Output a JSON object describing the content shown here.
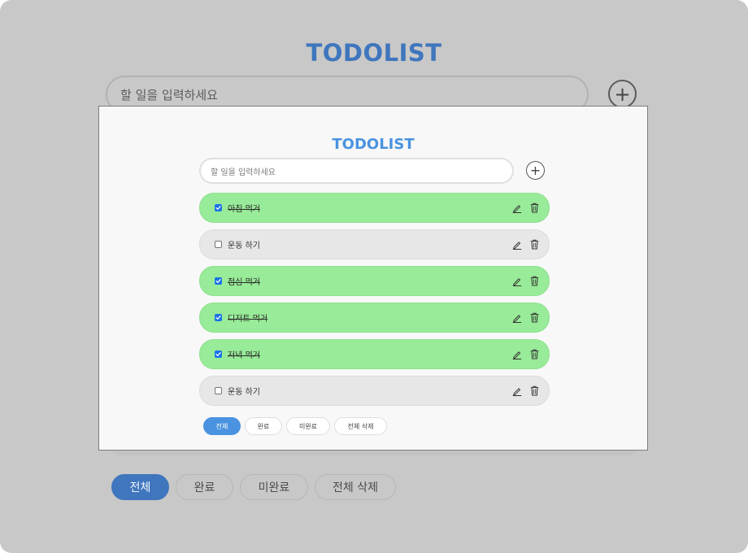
{
  "background": {
    "title": "TODOLIST",
    "input_placeholder": "할 일을 입력하세요",
    "add_symbol": "+",
    "filters": [
      "전체",
      "완료",
      "미완료",
      "전체 삭제"
    ]
  },
  "modal": {
    "title": "TODOLIST",
    "input_placeholder": "할 일을 입력하세요",
    "add_symbol": "+",
    "todos": [
      {
        "text": "아침 먹거",
        "done": true
      },
      {
        "text": "운동 하기",
        "done": false
      },
      {
        "text": "점심 먹거",
        "done": true
      },
      {
        "text": "디저트 먹거",
        "done": true
      },
      {
        "text": "저녁 먹거",
        "done": true
      },
      {
        "text": "운동 하기",
        "done": false
      }
    ],
    "filters": [
      "전체",
      "완료",
      "미완료",
      "전체 삭제"
    ],
    "active_filter": "전체"
  },
  "colors": {
    "accent": "#4a93e0",
    "done_item": "#98eb98",
    "pending_item": "#e7e7e7"
  },
  "icons": {
    "edit": "pencil-icon",
    "delete": "trash-icon",
    "add": "plus-circle-icon"
  }
}
